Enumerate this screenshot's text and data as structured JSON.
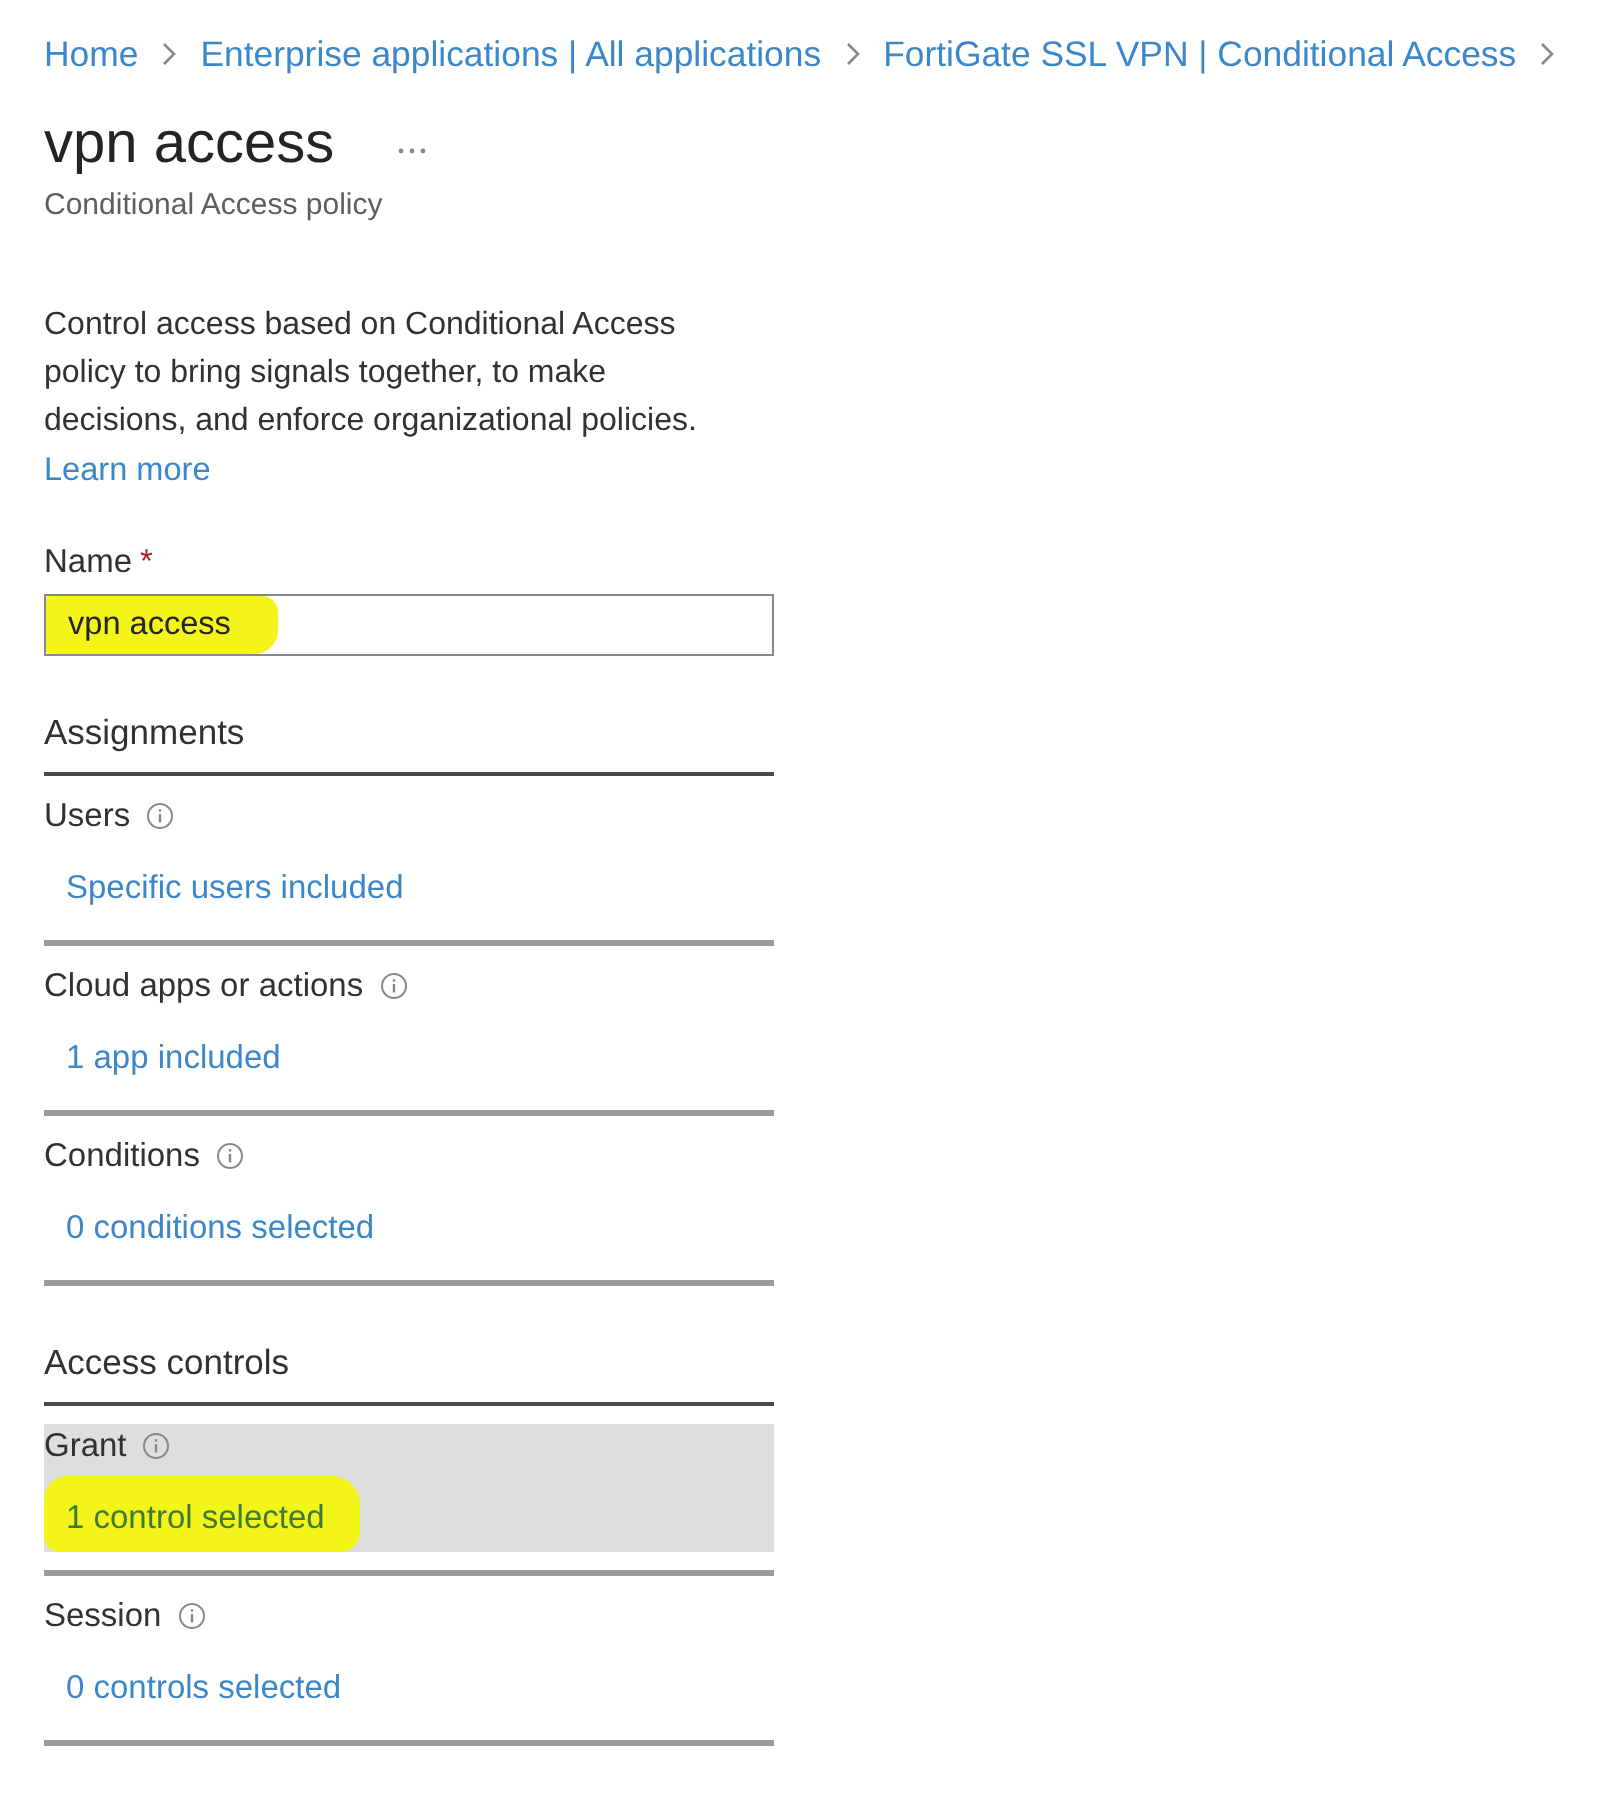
{
  "breadcrumb": [
    {
      "label": "Home"
    },
    {
      "label": "Enterprise applications | All applications"
    },
    {
      "label": "FortiGate SSL VPN | Conditional Access"
    }
  ],
  "header": {
    "title": "vpn access",
    "subtitle": "Conditional Access policy"
  },
  "description": {
    "text": "Control access based on Conditional Access policy to bring signals together, to make decisions, and enforce organizational policies.",
    "link": "Learn more"
  },
  "name_field": {
    "label": "Name",
    "required_mark": "*",
    "value": "vpn access",
    "highlighted": true
  },
  "sections": [
    {
      "heading": "Assignments",
      "items": [
        {
          "label": "Users",
          "value": "Specific users included",
          "selected": false,
          "highlighted": false
        },
        {
          "label": "Cloud apps or actions",
          "value": "1 app included",
          "selected": false,
          "highlighted": false
        },
        {
          "label": "Conditions",
          "value": "0 conditions selected",
          "selected": false,
          "highlighted": false
        }
      ]
    },
    {
      "heading": "Access controls",
      "items": [
        {
          "label": "Grant",
          "value": "1 control selected",
          "selected": true,
          "highlighted": true
        },
        {
          "label": "Session",
          "value": "0 controls selected",
          "selected": false,
          "highlighted": false
        }
      ]
    }
  ]
}
